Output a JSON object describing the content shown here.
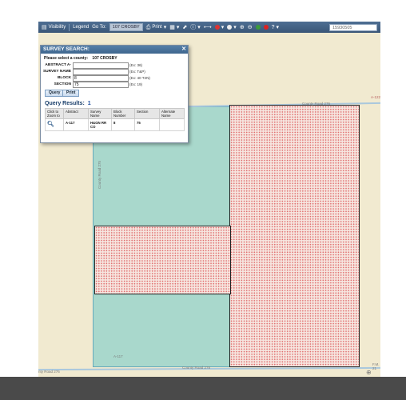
{
  "toolbar": {
    "visibility": "Visibility",
    "legend": "Legend",
    "goto_label": "Go To:",
    "goto_value": "107 CROSBY",
    "print": "Print",
    "search_value": "15930505"
  },
  "dialog": {
    "title": "SURVEY SEARCH:",
    "county_prompt": "Please select a county:",
    "county_value": "107 CROSBY",
    "fields": [
      {
        "label": "ABSTRACT A-",
        "value": "",
        "hint": "(Ex: 36)"
      },
      {
        "label": "SURVEY NAME",
        "value": "",
        "hint": "(Ex: T&P)"
      },
      {
        "label": "BLOCK",
        "value": "8",
        "hint": "(Ex: 40 T2N)"
      },
      {
        "label": "SECTION",
        "value": "75",
        "hint": "(Ex: 19)"
      }
    ],
    "query_button": "Query",
    "print_button": "Print",
    "results_label": "Query Results:",
    "results_count": "1",
    "columns": [
      "Click to Zoom to",
      "Abstract",
      "Survey Name",
      "Block Number",
      "Section",
      "Alternate Name"
    ],
    "rows": [
      {
        "abstract": "A-117",
        "survey_name": "H&GN RR CO",
        "block": "8",
        "section": "75",
        "alternate": ""
      }
    ]
  },
  "map": {
    "road_top": "County Road 276",
    "road_left": "County Road 275",
    "road_bottom": "County Road 278",
    "road_bottom_left": "nty Road 276",
    "label_a117": "A-117",
    "label_a122": "A-122",
    "label_fm": "F.M. 21"
  }
}
